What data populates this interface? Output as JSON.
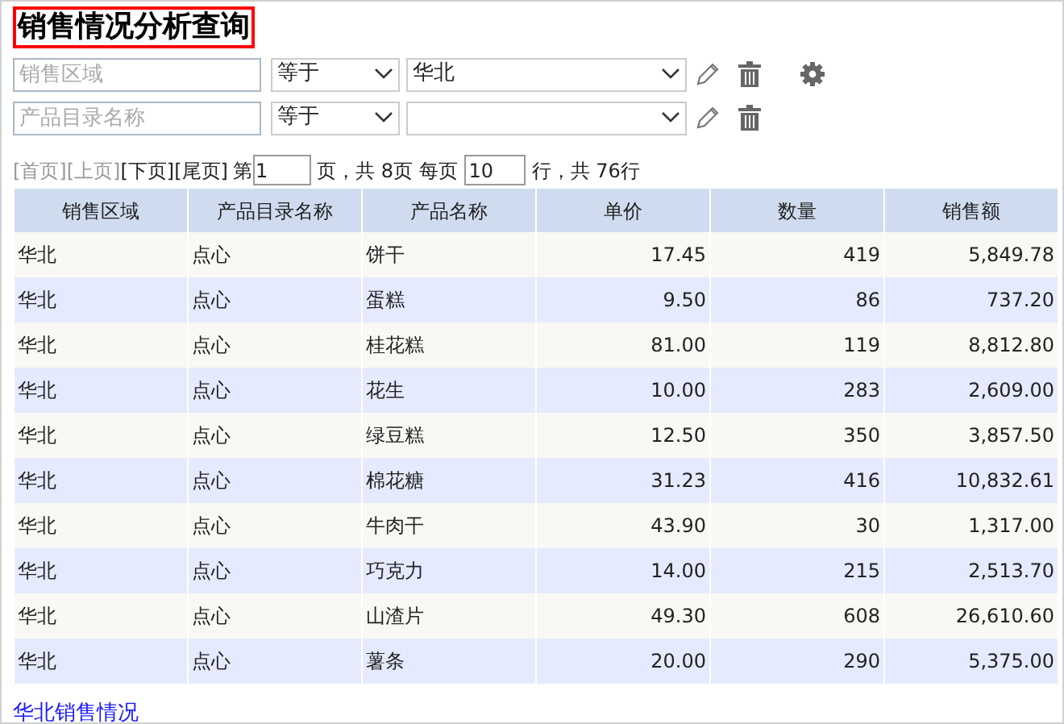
{
  "title": "销售情况分析查询",
  "filters": [
    {
      "field_placeholder": "销售区域",
      "operator": "等于",
      "value": "华北",
      "settings": true
    },
    {
      "field_placeholder": "产品目录名称",
      "operator": "等于",
      "settings": false
    }
  ],
  "pager": {
    "links": [
      {
        "label": "[首页]",
        "disabled": true
      },
      {
        "label": "[上页]",
        "disabled": true
      },
      {
        "label": "[下页]",
        "disabled": false
      },
      {
        "label": "[尾页]",
        "disabled": false
      }
    ],
    "page_prefix": "第",
    "page": "1",
    "page_suffix": "页，共 8页 每页",
    "per_page": "10",
    "total": "行，共 76行"
  },
  "table": {
    "columns": [
      {
        "label": "销售区域",
        "kind": "text"
      },
      {
        "label": "产品目录名称",
        "kind": "text"
      },
      {
        "label": "产品名称",
        "kind": "text"
      },
      {
        "label": "单价",
        "kind": "number"
      },
      {
        "label": "数量",
        "kind": "number"
      },
      {
        "label": "销售额",
        "kind": "number"
      }
    ],
    "rows": [
      [
        "华北",
        "点心",
        "饼干",
        "17.45",
        "419",
        "5,849.78"
      ],
      [
        "华北",
        "点心",
        "蛋糕",
        "9.50",
        "86",
        "737.20"
      ],
      [
        "华北",
        "点心",
        "桂花糕",
        "81.00",
        "119",
        "8,812.80"
      ],
      [
        "华北",
        "点心",
        "花生",
        "10.00",
        "283",
        "2,609.00"
      ],
      [
        "华北",
        "点心",
        "绿豆糕",
        "12.50",
        "350",
        "3,857.50"
      ],
      [
        "华北",
        "点心",
        "棉花糖",
        "31.23",
        "416",
        "10,832.61"
      ],
      [
        "华北",
        "点心",
        "牛肉干",
        "43.90",
        "30",
        "1,317.00"
      ],
      [
        "华北",
        "点心",
        "巧克力",
        "14.00",
        "215",
        "2,513.70"
      ],
      [
        "华北",
        "点心",
        "山渣片",
        "49.30",
        "608",
        "26,610.60"
      ],
      [
        "华北",
        "点心",
        "薯条",
        "20.00",
        "290",
        "5,375.00"
      ]
    ]
  },
  "footer_link": "华北销售情况"
}
